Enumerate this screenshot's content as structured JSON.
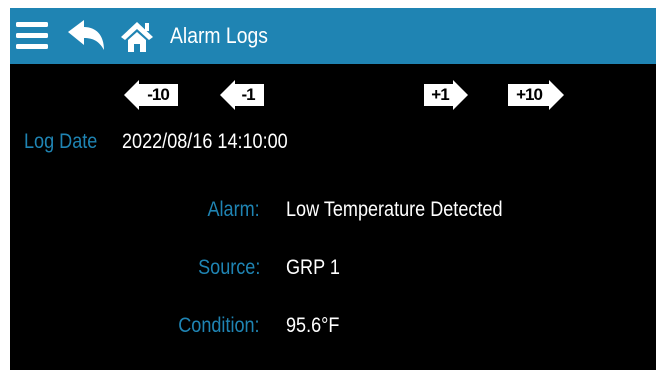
{
  "header": {
    "title": "Alarm Logs",
    "color": "#1f84b3",
    "icons": {
      "menu": "hamburger-menu-icon",
      "back": "back-arrow-icon",
      "home": "home-icon"
    }
  },
  "navigation": {
    "minus10_label": "-10",
    "minus1_label": "-1",
    "plus1_label": "+1",
    "plus10_label": "+10"
  },
  "log": {
    "date_label": "Log Date",
    "date_value": "2022/08/16 14:10:00",
    "alarm_label": "Alarm:",
    "alarm_value": "Low Temperature Detected",
    "source_label": "Source:",
    "source_value": "GRP 1",
    "condition_label": "Condition:",
    "condition_value": "95.6°F"
  },
  "colors": {
    "accent": "#1f84b3",
    "background": "#000000",
    "text": "#ffffff"
  }
}
